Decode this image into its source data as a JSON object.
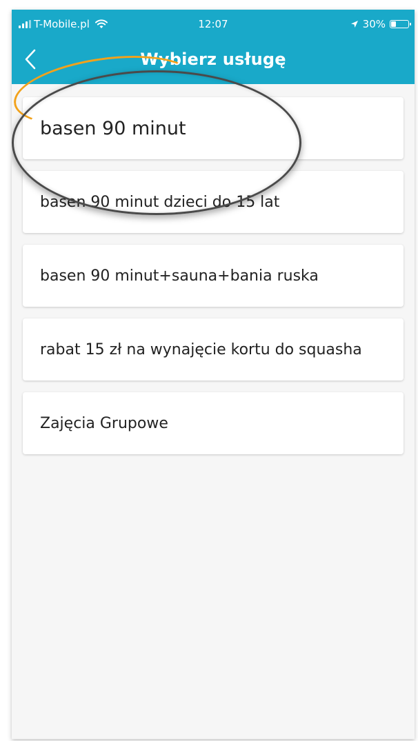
{
  "status_bar": {
    "carrier": "T-Mobile.pl",
    "time": "12:07",
    "battery": "30%",
    "battery_level": 0.3,
    "icons": [
      "signal-icon",
      "wifi-icon",
      "location-arrow-icon",
      "battery-icon"
    ]
  },
  "header": {
    "title": "Wybierz usługę",
    "back_icon": "chevron-left-icon"
  },
  "services": [
    {
      "label": "basen 90 minut"
    },
    {
      "label": "basen 90 minut dzieci do 15 lat"
    },
    {
      "label": "basen 90 minut+sauna+bania ruska"
    },
    {
      "label": "rabat 15 zł na wynajęcie kortu do squasha"
    },
    {
      "label": "Zajęcia Grupowe"
    }
  ],
  "colors": {
    "header_bg": "#19a9c9",
    "highlight": "#f2a21b",
    "background": "#f6f6f6",
    "card_bg": "#ffffff"
  }
}
